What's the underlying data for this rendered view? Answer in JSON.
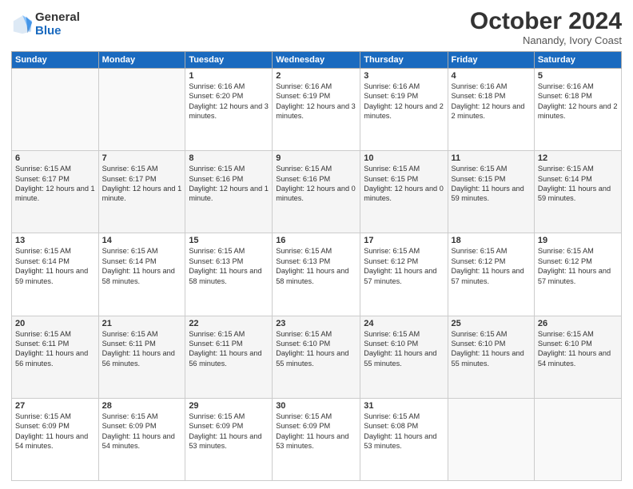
{
  "header": {
    "logo_general": "General",
    "logo_blue": "Blue",
    "month_title": "October 2024",
    "location": "Nanandy, Ivory Coast"
  },
  "weekdays": [
    "Sunday",
    "Monday",
    "Tuesday",
    "Wednesday",
    "Thursday",
    "Friday",
    "Saturday"
  ],
  "weeks": [
    [
      {
        "day": "",
        "info": ""
      },
      {
        "day": "",
        "info": ""
      },
      {
        "day": "1",
        "info": "Sunrise: 6:16 AM\nSunset: 6:20 PM\nDaylight: 12 hours and 3 minutes."
      },
      {
        "day": "2",
        "info": "Sunrise: 6:16 AM\nSunset: 6:19 PM\nDaylight: 12 hours and 3 minutes."
      },
      {
        "day": "3",
        "info": "Sunrise: 6:16 AM\nSunset: 6:19 PM\nDaylight: 12 hours and 2 minutes."
      },
      {
        "day": "4",
        "info": "Sunrise: 6:16 AM\nSunset: 6:18 PM\nDaylight: 12 hours and 2 minutes."
      },
      {
        "day": "5",
        "info": "Sunrise: 6:16 AM\nSunset: 6:18 PM\nDaylight: 12 hours and 2 minutes."
      }
    ],
    [
      {
        "day": "6",
        "info": "Sunrise: 6:15 AM\nSunset: 6:17 PM\nDaylight: 12 hours and 1 minute."
      },
      {
        "day": "7",
        "info": "Sunrise: 6:15 AM\nSunset: 6:17 PM\nDaylight: 12 hours and 1 minute."
      },
      {
        "day": "8",
        "info": "Sunrise: 6:15 AM\nSunset: 6:16 PM\nDaylight: 12 hours and 1 minute."
      },
      {
        "day": "9",
        "info": "Sunrise: 6:15 AM\nSunset: 6:16 PM\nDaylight: 12 hours and 0 minutes."
      },
      {
        "day": "10",
        "info": "Sunrise: 6:15 AM\nSunset: 6:15 PM\nDaylight: 12 hours and 0 minutes."
      },
      {
        "day": "11",
        "info": "Sunrise: 6:15 AM\nSunset: 6:15 PM\nDaylight: 11 hours and 59 minutes."
      },
      {
        "day": "12",
        "info": "Sunrise: 6:15 AM\nSunset: 6:14 PM\nDaylight: 11 hours and 59 minutes."
      }
    ],
    [
      {
        "day": "13",
        "info": "Sunrise: 6:15 AM\nSunset: 6:14 PM\nDaylight: 11 hours and 59 minutes."
      },
      {
        "day": "14",
        "info": "Sunrise: 6:15 AM\nSunset: 6:14 PM\nDaylight: 11 hours and 58 minutes."
      },
      {
        "day": "15",
        "info": "Sunrise: 6:15 AM\nSunset: 6:13 PM\nDaylight: 11 hours and 58 minutes."
      },
      {
        "day": "16",
        "info": "Sunrise: 6:15 AM\nSunset: 6:13 PM\nDaylight: 11 hours and 58 minutes."
      },
      {
        "day": "17",
        "info": "Sunrise: 6:15 AM\nSunset: 6:12 PM\nDaylight: 11 hours and 57 minutes."
      },
      {
        "day": "18",
        "info": "Sunrise: 6:15 AM\nSunset: 6:12 PM\nDaylight: 11 hours and 57 minutes."
      },
      {
        "day": "19",
        "info": "Sunrise: 6:15 AM\nSunset: 6:12 PM\nDaylight: 11 hours and 57 minutes."
      }
    ],
    [
      {
        "day": "20",
        "info": "Sunrise: 6:15 AM\nSunset: 6:11 PM\nDaylight: 11 hours and 56 minutes."
      },
      {
        "day": "21",
        "info": "Sunrise: 6:15 AM\nSunset: 6:11 PM\nDaylight: 11 hours and 56 minutes."
      },
      {
        "day": "22",
        "info": "Sunrise: 6:15 AM\nSunset: 6:11 PM\nDaylight: 11 hours and 56 minutes."
      },
      {
        "day": "23",
        "info": "Sunrise: 6:15 AM\nSunset: 6:10 PM\nDaylight: 11 hours and 55 minutes."
      },
      {
        "day": "24",
        "info": "Sunrise: 6:15 AM\nSunset: 6:10 PM\nDaylight: 11 hours and 55 minutes."
      },
      {
        "day": "25",
        "info": "Sunrise: 6:15 AM\nSunset: 6:10 PM\nDaylight: 11 hours and 55 minutes."
      },
      {
        "day": "26",
        "info": "Sunrise: 6:15 AM\nSunset: 6:10 PM\nDaylight: 11 hours and 54 minutes."
      }
    ],
    [
      {
        "day": "27",
        "info": "Sunrise: 6:15 AM\nSunset: 6:09 PM\nDaylight: 11 hours and 54 minutes."
      },
      {
        "day": "28",
        "info": "Sunrise: 6:15 AM\nSunset: 6:09 PM\nDaylight: 11 hours and 54 minutes."
      },
      {
        "day": "29",
        "info": "Sunrise: 6:15 AM\nSunset: 6:09 PM\nDaylight: 11 hours and 53 minutes."
      },
      {
        "day": "30",
        "info": "Sunrise: 6:15 AM\nSunset: 6:09 PM\nDaylight: 11 hours and 53 minutes."
      },
      {
        "day": "31",
        "info": "Sunrise: 6:15 AM\nSunset: 6:08 PM\nDaylight: 11 hours and 53 minutes."
      },
      {
        "day": "",
        "info": ""
      },
      {
        "day": "",
        "info": ""
      }
    ]
  ]
}
